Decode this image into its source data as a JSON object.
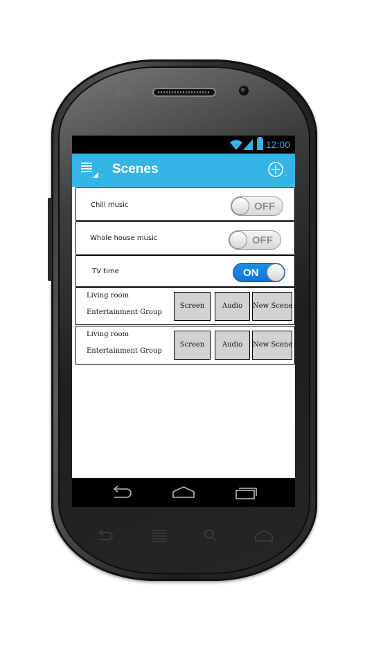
{
  "status_bar": {
    "time": "12:00"
  },
  "action_bar": {
    "title": "Scenes"
  },
  "scenes": [
    {
      "label": "Chill music",
      "state": "OFF"
    },
    {
      "label": "Whole house music",
      "state": "OFF"
    },
    {
      "label": "TV time",
      "state": "ON"
    }
  ],
  "groups": [
    {
      "line1": "Living room",
      "line2": "Entertainment Group",
      "buttons": [
        "Screen",
        "Audio",
        "New Scene"
      ]
    },
    {
      "line1": "Living room",
      "line2": "Entertainment Group",
      "buttons": [
        "Screen",
        "Audio",
        "New Scene"
      ]
    }
  ],
  "colors": {
    "accent": "#33b5e5",
    "toggle_on": "#1a86e8"
  }
}
